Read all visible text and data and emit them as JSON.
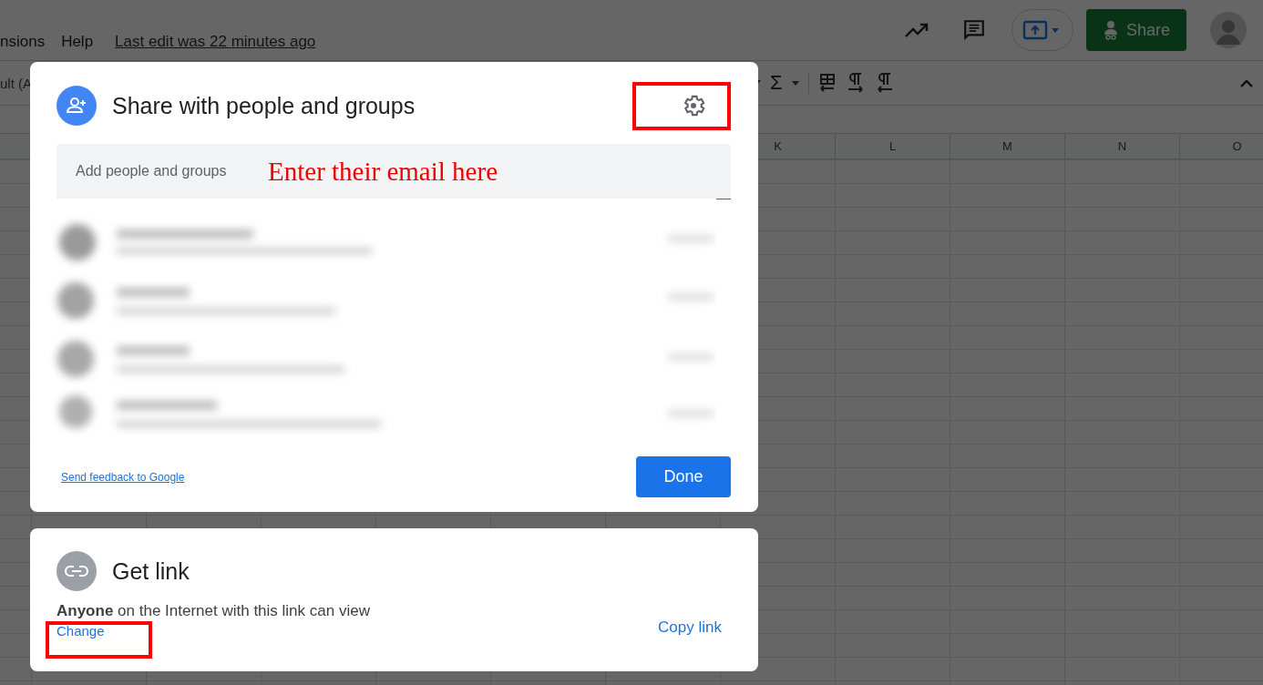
{
  "menu_bar": {
    "items": [
      "nsions",
      "Help"
    ],
    "last_edit": "Last edit was 22 minutes ago"
  },
  "header_actions": {
    "share_button": "Share"
  },
  "toolbar": {
    "font_field": "ult (A",
    "sum_symbol": "Σ"
  },
  "columns": [
    "K",
    "L",
    "M",
    "N",
    "O"
  ],
  "share_dialog": {
    "title": "Share with people and groups",
    "add_field": {
      "placeholder": "Add people and groups"
    },
    "feedback_link": "Send feedback to Google",
    "done_button": "Done"
  },
  "link_dialog": {
    "title": "Get link",
    "access_text": "**Anyone** on the Internet with this link can view",
    "change_link": "Change",
    "copy_button": "Copy link"
  },
  "annotations": {
    "email_hint": "Enter their email here",
    "highlight_settings": true,
    "highlight_change": true
  }
}
